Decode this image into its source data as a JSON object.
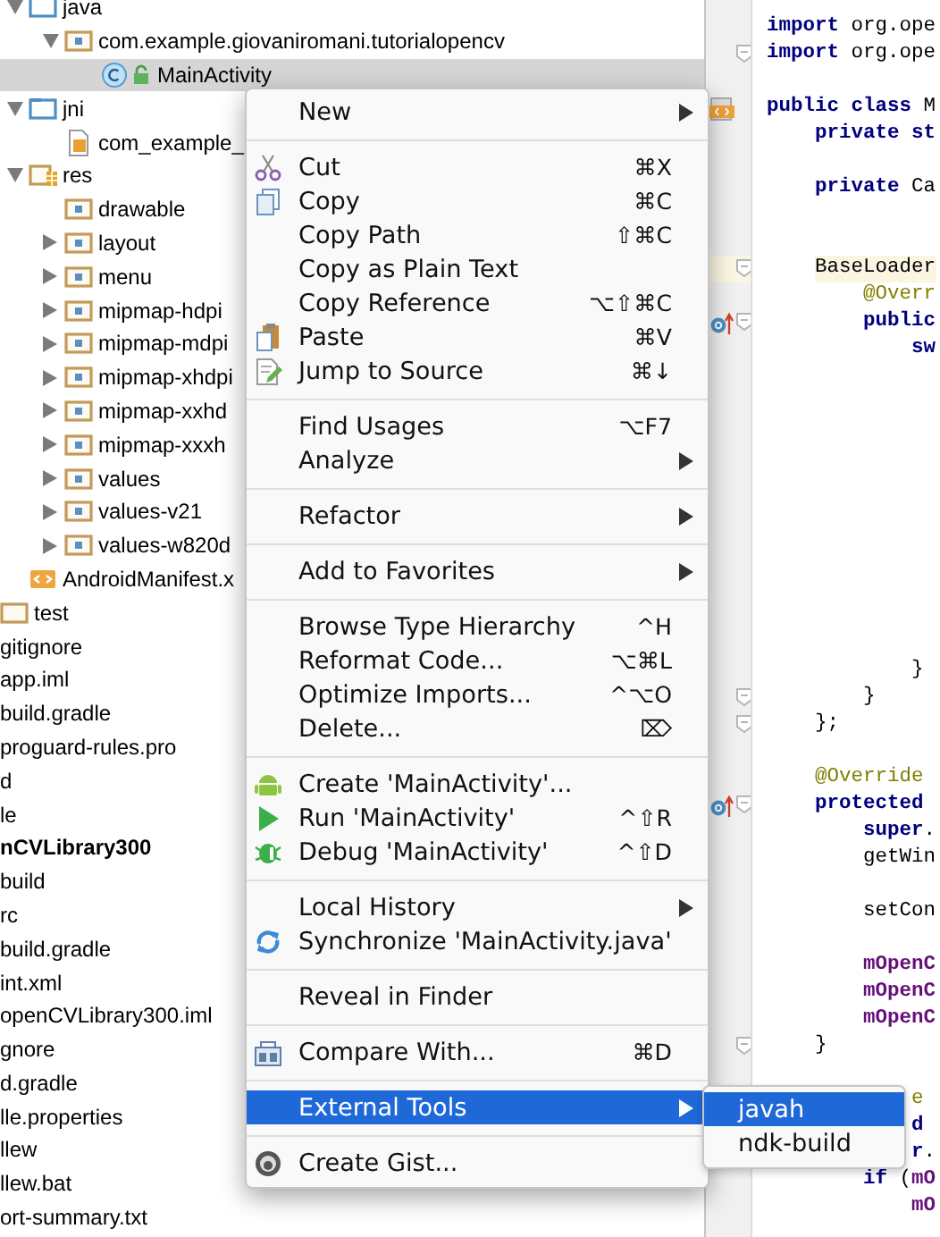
{
  "project_tree": {
    "main_items": [
      {
        "label": "java",
        "kind": "source_folder",
        "expanded": true,
        "selected": false,
        "children": [
          {
            "label": "com.example.giovaniromani.tutorialopencv",
            "kind": "package",
            "expanded": true,
            "selected": false,
            "children": [
              {
                "label": "MainActivity",
                "kind": "class",
                "selected": true
              }
            ]
          }
        ]
      },
      {
        "label": "jni",
        "kind": "source_folder",
        "expanded": true,
        "selected": false,
        "children": [
          {
            "label": "com_example_",
            "kind": "header_file",
            "selected": false
          }
        ]
      },
      {
        "label": "res",
        "kind": "res_folder",
        "expanded": true,
        "selected": false,
        "children": [
          {
            "label": "drawable",
            "kind": "folder",
            "selected": false
          },
          {
            "label": "layout",
            "kind": "folder",
            "expanded": false,
            "selected": false
          },
          {
            "label": "menu",
            "kind": "folder",
            "expanded": false,
            "selected": false
          },
          {
            "label": "mipmap-hdpi",
            "kind": "folder",
            "expanded": false,
            "selected": false
          },
          {
            "label": "mipmap-mdpi",
            "kind": "folder",
            "expanded": false,
            "selected": false
          },
          {
            "label": "mipmap-xhdpi",
            "kind": "folder",
            "expanded": false,
            "selected": false
          },
          {
            "label": "mipmap-xxhd",
            "kind": "folder",
            "expanded": false,
            "selected": false
          },
          {
            "label": "mipmap-xxxh",
            "kind": "folder",
            "expanded": false,
            "selected": false
          },
          {
            "label": "values",
            "kind": "folder",
            "expanded": false,
            "selected": false
          },
          {
            "label": "values-v21",
            "kind": "folder",
            "expanded": false,
            "selected": false
          },
          {
            "label": "values-w820d",
            "kind": "folder",
            "expanded": false,
            "selected": false
          }
        ]
      },
      {
        "label": "AndroidManifest.x",
        "kind": "manifest",
        "selected": false
      }
    ],
    "src_items": [
      {
        "label": "test",
        "kind": "plain_folder",
        "selected": false
      }
    ],
    "module_items": [
      {
        "label": "gitignore",
        "kind": "file",
        "selected": false
      },
      {
        "label": "app.iml",
        "kind": "file",
        "selected": false
      },
      {
        "label": "build.gradle",
        "kind": "file",
        "selected": false
      },
      {
        "label": "proguard-rules.pro",
        "kind": "file",
        "selected": false
      },
      {
        "label": "d",
        "kind": "file",
        "selected": false
      },
      {
        "label": "le",
        "kind": "file",
        "selected": false
      },
      {
        "label": "nCVLibrary300",
        "kind": "module",
        "selected": false
      },
      {
        "label": "build",
        "kind": "file",
        "selected": false
      },
      {
        "label": "rc",
        "kind": "file",
        "selected": false
      },
      {
        "label": "build.gradle",
        "kind": "file",
        "selected": false
      },
      {
        "label": "int.xml",
        "kind": "file",
        "selected": false
      },
      {
        "label": "openCVLibrary300.iml",
        "kind": "file",
        "selected": false
      },
      {
        "label": "gnore",
        "kind": "file",
        "selected": false
      },
      {
        "label": "d.gradle",
        "kind": "file",
        "selected": false
      },
      {
        "label": "lle.properties",
        "kind": "file",
        "selected": false
      },
      {
        "label": "llew",
        "kind": "file",
        "selected": false
      },
      {
        "label": "llew.bat",
        "kind": "file",
        "selected": false
      },
      {
        "label": "ort-summary.txt",
        "kind": "file",
        "selected": false
      }
    ]
  },
  "editor": {
    "lines": [
      {
        "kind": "code",
        "tokens": [
          {
            "text": "import",
            "kind": "keyword"
          },
          {
            "text": " org.ope",
            "kind": "plain"
          }
        ]
      },
      {
        "kind": "code",
        "fold": true,
        "tokens": [
          {
            "text": "import",
            "kind": "keyword"
          },
          {
            "text": " org.ope",
            "kind": "plain"
          }
        ]
      },
      {
        "kind": "blank"
      },
      {
        "kind": "code",
        "tokens": [
          {
            "text": "public class",
            "kind": "keyword"
          },
          {
            "text": " M",
            "kind": "plain"
          }
        ]
      },
      {
        "kind": "code",
        "tokens": [
          {
            "text": "    private st",
            "kind": "keyword"
          }
        ]
      },
      {
        "kind": "blank"
      },
      {
        "kind": "code",
        "tokens": [
          {
            "text": "    private",
            "kind": "keyword"
          },
          {
            "text": " Ca",
            "kind": "plain"
          }
        ]
      },
      {
        "kind": "blank"
      },
      {
        "kind": "blank"
      },
      {
        "kind": "code",
        "highlighted": true,
        "fold": true,
        "tokens": [
          {
            "text": "    BaseLoader",
            "kind": "plain"
          }
        ]
      },
      {
        "kind": "code",
        "tokens": [
          {
            "text": "        @Overr",
            "kind": "annotation"
          }
        ]
      },
      {
        "kind": "code",
        "fold": true,
        "tokens": [
          {
            "text": "        public",
            "kind": "keyword"
          }
        ]
      },
      {
        "kind": "code",
        "tokens": [
          {
            "text": "            sw",
            "kind": "keyword"
          }
        ]
      },
      {
        "kind": "blank"
      },
      {
        "kind": "blank"
      },
      {
        "kind": "blank"
      },
      {
        "kind": "blank"
      },
      {
        "kind": "blank"
      },
      {
        "kind": "blank"
      },
      {
        "kind": "blank"
      },
      {
        "kind": "blank"
      },
      {
        "kind": "blank"
      },
      {
        "kind": "blank"
      },
      {
        "kind": "blank"
      },
      {
        "kind": "code",
        "tokens": [
          {
            "text": "            }",
            "kind": "plain"
          }
        ]
      },
      {
        "kind": "code",
        "fold": true,
        "tokens": [
          {
            "text": "        }",
            "kind": "plain"
          }
        ]
      },
      {
        "kind": "code",
        "fold": true,
        "tokens": [
          {
            "text": "    };",
            "kind": "plain"
          }
        ]
      },
      {
        "kind": "blank"
      },
      {
        "kind": "code",
        "tokens": [
          {
            "text": "    @Override",
            "kind": "annotation"
          }
        ]
      },
      {
        "kind": "code",
        "fold": true,
        "tokens": [
          {
            "text": "    protected",
            "kind": "keyword"
          }
        ]
      },
      {
        "kind": "code",
        "tokens": [
          {
            "text": "        super",
            "kind": "keyword"
          },
          {
            "text": ".",
            "kind": "plain"
          }
        ]
      },
      {
        "kind": "code",
        "tokens": [
          {
            "text": "        getWin",
            "kind": "plain"
          }
        ]
      },
      {
        "kind": "blank"
      },
      {
        "kind": "code",
        "tokens": [
          {
            "text": "        setCon",
            "kind": "plain"
          }
        ]
      },
      {
        "kind": "blank"
      },
      {
        "kind": "code",
        "tokens": [
          {
            "text": "        mOpenC",
            "kind": "field"
          }
        ]
      },
      {
        "kind": "code",
        "tokens": [
          {
            "text": "        mOpenC",
            "kind": "field"
          }
        ]
      },
      {
        "kind": "code",
        "tokens": [
          {
            "text": "        mOpenC",
            "kind": "field"
          }
        ]
      },
      {
        "kind": "code",
        "fold": true,
        "tokens": [
          {
            "text": "    }",
            "kind": "plain"
          }
        ]
      },
      {
        "kind": "blank"
      },
      {
        "kind": "code",
        "tokens": [
          {
            "text": "            e",
            "kind": "annotation"
          }
        ]
      },
      {
        "kind": "code",
        "tokens": [
          {
            "text": "            d",
            "kind": "keyword"
          }
        ]
      },
      {
        "kind": "code",
        "tokens": [
          {
            "text": "            r",
            "kind": "keyword"
          },
          {
            "text": ".",
            "kind": "plain"
          }
        ]
      },
      {
        "kind": "code",
        "tokens": [
          {
            "text": "        if",
            "kind": "keyword"
          },
          {
            "text": " (",
            "kind": "plain"
          },
          {
            "text": "mO",
            "kind": "field"
          }
        ]
      },
      {
        "kind": "code",
        "tokens": [
          {
            "text": "            mO",
            "kind": "field"
          }
        ]
      }
    ]
  },
  "context_menu": {
    "items": [
      {
        "kind": "item",
        "label": "New",
        "has_submenu": true,
        "selected": false
      },
      {
        "kind": "separator"
      },
      {
        "kind": "item",
        "label": "Cut",
        "shortcut": "⌘X",
        "has_submenu": false,
        "selected": false
      },
      {
        "kind": "item",
        "label": "Copy",
        "shortcut": "⌘C",
        "has_submenu": false,
        "selected": false
      },
      {
        "kind": "item",
        "label": "Copy Path",
        "shortcut": "⇧⌘C",
        "has_submenu": false,
        "selected": false
      },
      {
        "kind": "item",
        "label": "Copy as Plain Text",
        "has_submenu": false,
        "selected": false
      },
      {
        "kind": "item",
        "label": "Copy Reference",
        "shortcut": "⌥⇧⌘C",
        "has_submenu": false,
        "selected": false
      },
      {
        "kind": "item",
        "label": "Paste",
        "shortcut": "⌘V",
        "has_submenu": false,
        "selected": false
      },
      {
        "kind": "item",
        "label": "Jump to Source",
        "shortcut": "⌘↓",
        "has_submenu": false,
        "selected": false
      },
      {
        "kind": "separator"
      },
      {
        "kind": "item",
        "label": "Find Usages",
        "shortcut": "⌥F7",
        "has_submenu": false,
        "selected": false
      },
      {
        "kind": "item",
        "label": "Analyze",
        "has_submenu": true,
        "selected": false
      },
      {
        "kind": "separator"
      },
      {
        "kind": "item",
        "label": "Refactor",
        "has_submenu": true,
        "selected": false
      },
      {
        "kind": "separator"
      },
      {
        "kind": "item",
        "label": "Add to Favorites",
        "has_submenu": true,
        "selected": false
      },
      {
        "kind": "separator"
      },
      {
        "kind": "item",
        "label": "Browse Type Hierarchy",
        "shortcut": "^H",
        "has_submenu": false,
        "selected": false
      },
      {
        "kind": "item",
        "label": "Reformat Code...",
        "shortcut": "⌥⌘L",
        "has_submenu": false,
        "selected": false
      },
      {
        "kind": "item",
        "label": "Optimize Imports...",
        "shortcut": "^⌥O",
        "has_submenu": false,
        "selected": false
      },
      {
        "kind": "item",
        "label": "Delete...",
        "shortcut": "⌦",
        "has_submenu": false,
        "selected": false
      },
      {
        "kind": "separator"
      },
      {
        "kind": "item",
        "label": "Create 'MainActivity'...",
        "has_submenu": false,
        "selected": false
      },
      {
        "kind": "item",
        "label": "Run 'MainActivity'",
        "shortcut": "^⇧R",
        "has_submenu": false,
        "selected": false
      },
      {
        "kind": "item",
        "label": "Debug 'MainActivity'",
        "shortcut": "^⇧D",
        "has_submenu": false,
        "selected": false
      },
      {
        "kind": "separator"
      },
      {
        "kind": "item",
        "label": "Local History",
        "has_submenu": true,
        "selected": false
      },
      {
        "kind": "item",
        "label": "Synchronize 'MainActivity.java'",
        "has_submenu": false,
        "selected": false
      },
      {
        "kind": "separator"
      },
      {
        "kind": "item",
        "label": "Reveal in Finder",
        "has_submenu": false,
        "selected": false
      },
      {
        "kind": "separator"
      },
      {
        "kind": "item",
        "label": "Compare With...",
        "shortcut": "⌘D",
        "has_submenu": false,
        "selected": false
      },
      {
        "kind": "separator"
      },
      {
        "kind": "item",
        "label": "External Tools",
        "has_submenu": true,
        "selected": true
      },
      {
        "kind": "separator"
      },
      {
        "kind": "item",
        "label": "Create Gist...",
        "has_submenu": false,
        "selected": false
      }
    ]
  },
  "submenu": {
    "items": [
      {
        "label": "javah",
        "selected": true
      },
      {
        "label": "ndk-build",
        "selected": false
      }
    ]
  }
}
